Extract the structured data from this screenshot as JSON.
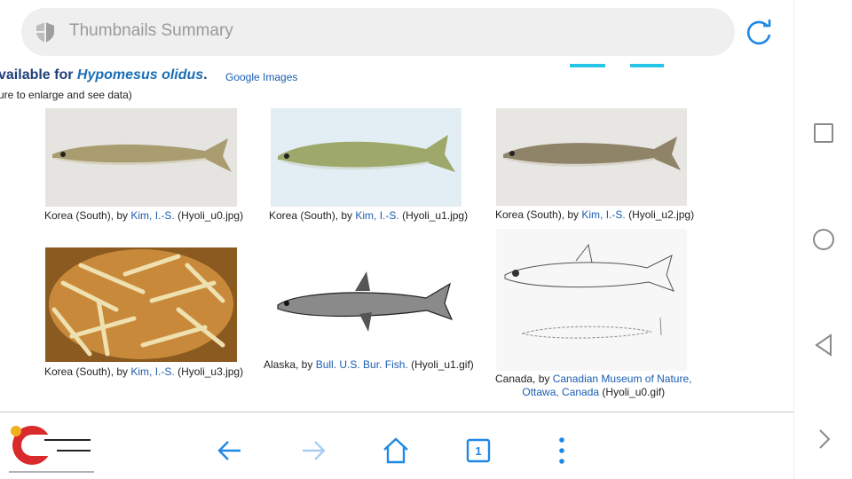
{
  "browser": {
    "url_text": "Thumbnails Summary",
    "tab_count": "1"
  },
  "page": {
    "heading_prefix": "vailable for ",
    "heading_species": "Hypomesus olidus",
    "heading_suffix": ".",
    "google_link": "Google Images",
    "hint": "ure to enlarge and see data)"
  },
  "thumbnails": [
    {
      "region": "Korea (South), by ",
      "author": "Kim, I.-S.",
      "file": " (Hyoli_u0.jpg)"
    },
    {
      "region": "Korea (South), by ",
      "author": "Kim, I.-S.",
      "file": " (Hyoli_u1.jpg)"
    },
    {
      "region": "Korea (South), by ",
      "author": "Kim, I.-S.",
      "file": " (Hyoli_u2.jpg)"
    },
    {
      "region": "Korea (South), by ",
      "author": "Kim, I.-S.",
      "file": " (Hyoli_u3.jpg)"
    },
    {
      "region": "Alaska, by ",
      "author": "Bull. U.S. Bur. Fish.",
      "file": " (Hyoli_u1.gif)"
    },
    {
      "region": "Canada, by ",
      "author_line1": "Canadian Museum of Nature,",
      "author_line2": "Ottawa, Canada",
      "file": " (Hyoli_u0.gif)"
    }
  ],
  "colors": {
    "link": "#1a5db0",
    "accent_blue": "#1e88e5",
    "heading": "#1f3f7a"
  },
  "icons": [
    "shield-icon",
    "reload-icon",
    "back-arrow-icon",
    "forward-arrow-icon",
    "home-icon",
    "tabs-icon",
    "more-vert-icon",
    "square-icon",
    "circle-icon",
    "triangle-back-icon",
    "chevron-right-icon"
  ]
}
